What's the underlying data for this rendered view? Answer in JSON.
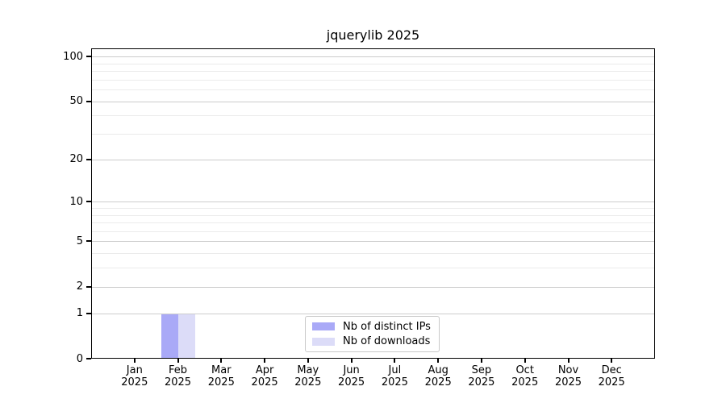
{
  "title": "jquerylib 2025",
  "colors": {
    "distinct_ips": "#a9a9f7",
    "downloads": "#dcdcf8",
    "grid_major": "#cccccc",
    "grid_minor": "#ebebeb",
    "axis": "#000000",
    "legend_border": "#c9c9c9",
    "background": "#ffffff",
    "text": "#000000"
  },
  "legend": {
    "items": [
      {
        "label": "Nb of distinct IPs",
        "color_key": "distinct_ips"
      },
      {
        "label": "Nb of downloads",
        "color_key": "downloads"
      }
    ]
  },
  "x_axis": {
    "months": [
      "Jan",
      "Feb",
      "Mar",
      "Apr",
      "May",
      "Jun",
      "Jul",
      "Aug",
      "Sep",
      "Oct",
      "Nov",
      "Dec"
    ],
    "year_label": "2025"
  },
  "y_axis": {
    "major_ticks": [
      0,
      1,
      2,
      5,
      10,
      20,
      50,
      100
    ],
    "major_tick_labels": [
      "0",
      "1",
      "2",
      "5",
      "10",
      "20",
      "50",
      "100"
    ],
    "minor_ticks": [
      3,
      4,
      6,
      7,
      8,
      9,
      30,
      40,
      60,
      70,
      80,
      90
    ]
  },
  "chart_data": {
    "type": "bar",
    "title": "jquerylib 2025",
    "categories": [
      "Jan 2025",
      "Feb 2025",
      "Mar 2025",
      "Apr 2025",
      "May 2025",
      "Jun 2025",
      "Jul 2025",
      "Aug 2025",
      "Sep 2025",
      "Oct 2025",
      "Nov 2025",
      "Dec 2025"
    ],
    "series": [
      {
        "name": "Nb of distinct IPs",
        "color_key": "distinct_ips",
        "values": [
          0,
          1,
          0,
          0,
          0,
          0,
          0,
          0,
          0,
          0,
          0,
          0
        ]
      },
      {
        "name": "Nb of downloads",
        "color_key": "downloads",
        "values": [
          0,
          1,
          0,
          0,
          0,
          0,
          0,
          0,
          0,
          0,
          0,
          0
        ]
      }
    ],
    "yscale": "log1p",
    "ylim": [
      0,
      115
    ],
    "ytick_labels": [
      "0",
      "1",
      "2",
      "5",
      "10",
      "20",
      "50",
      "100"
    ],
    "grid": "horizontal",
    "legend_position": "lower center"
  }
}
